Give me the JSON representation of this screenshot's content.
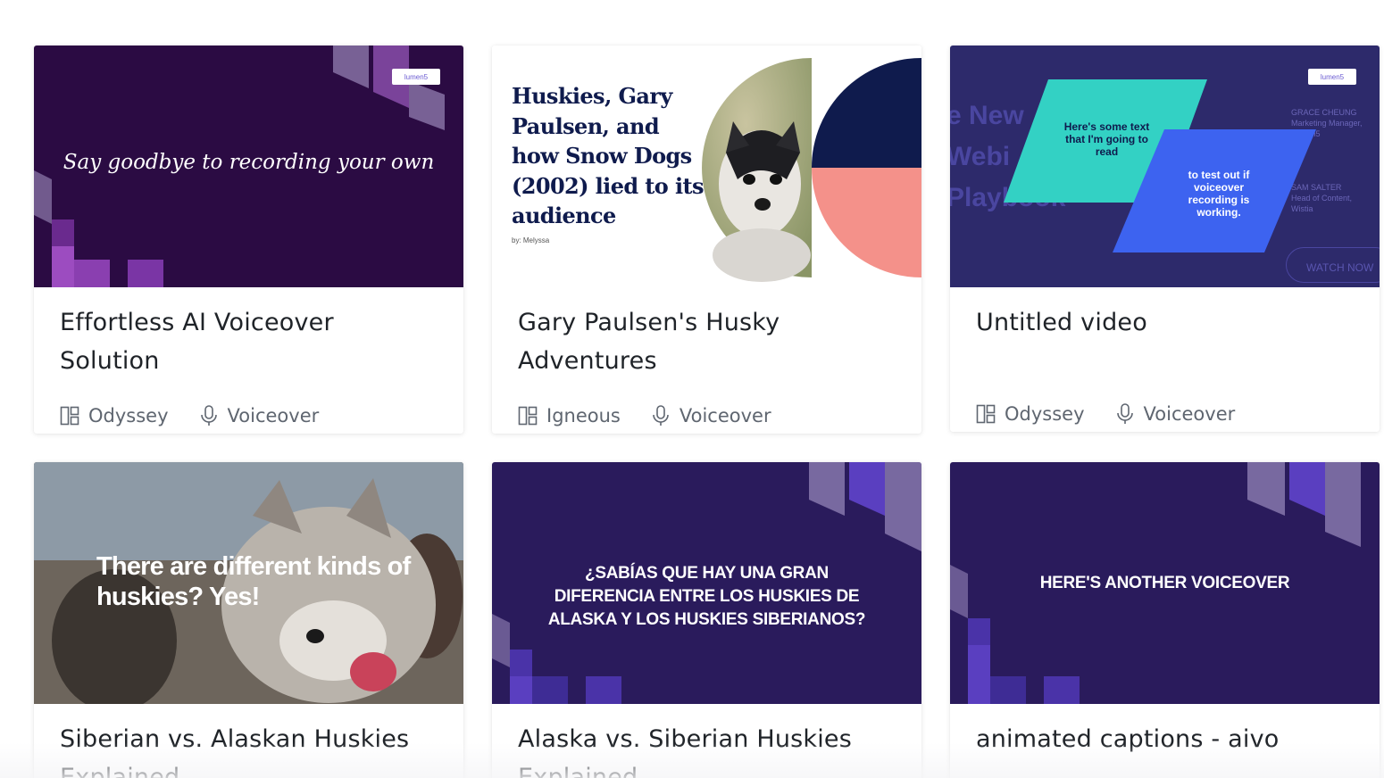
{
  "cards": [
    {
      "title": "Effortless AI Voiceover Solution",
      "theme": "Odyssey",
      "type": "Voiceover",
      "slide_text": "Say goodbye to recording your own",
      "logo": "lumen5"
    },
    {
      "title": "Gary Paulsen's Husky Adventures",
      "theme": "Igneous",
      "type": "Voiceover",
      "slide_heading": "Huskies, Gary Paulsen, and how Snow Dogs (2002) lied to its audience",
      "slide_byline": "by: Melyssa"
    },
    {
      "title": "Untitled video",
      "theme": "Odyssey",
      "type": "Voiceover",
      "slide_box1": "Here's some text that I'm going to read",
      "slide_box2": "to test out if voiceover recording is working.",
      "bg_words": "e New Webi Playbook",
      "person1": "GRACE CHEUNG",
      "person1_role": "Marketing Manager, Lumen5",
      "person2": "SAM SALTER",
      "person2_role": "Head of Content, Wistia",
      "cta": "WATCH NOW",
      "logo": "lumen5"
    },
    {
      "title": "Siberian vs. Alaskan Huskies Explained",
      "slide_text": "There are different kinds of huskies? Yes!"
    },
    {
      "title": "Alaska vs. Siberian Huskies Explained",
      "slide_text": "¿SABÍAS QUE HAY UNA GRAN DIFERENCIA ENTRE LOS HUSKIES DE ALASKA Y LOS HUSKIES SIBERIANOS?"
    },
    {
      "title": "animated captions - aivo",
      "slide_text": "HERE'S ANOTHER VOICEOVER"
    }
  ],
  "colors": {
    "odyssey_bg": "#2b0b43",
    "indigo_bg": "#2a1b5c",
    "teal": "#33d1c4",
    "blue": "#3d63f0",
    "salmon": "#f4918a",
    "navy": "#0f1b4d"
  },
  "icons": {
    "theme": "layout-icon",
    "type": "microphone-icon"
  }
}
